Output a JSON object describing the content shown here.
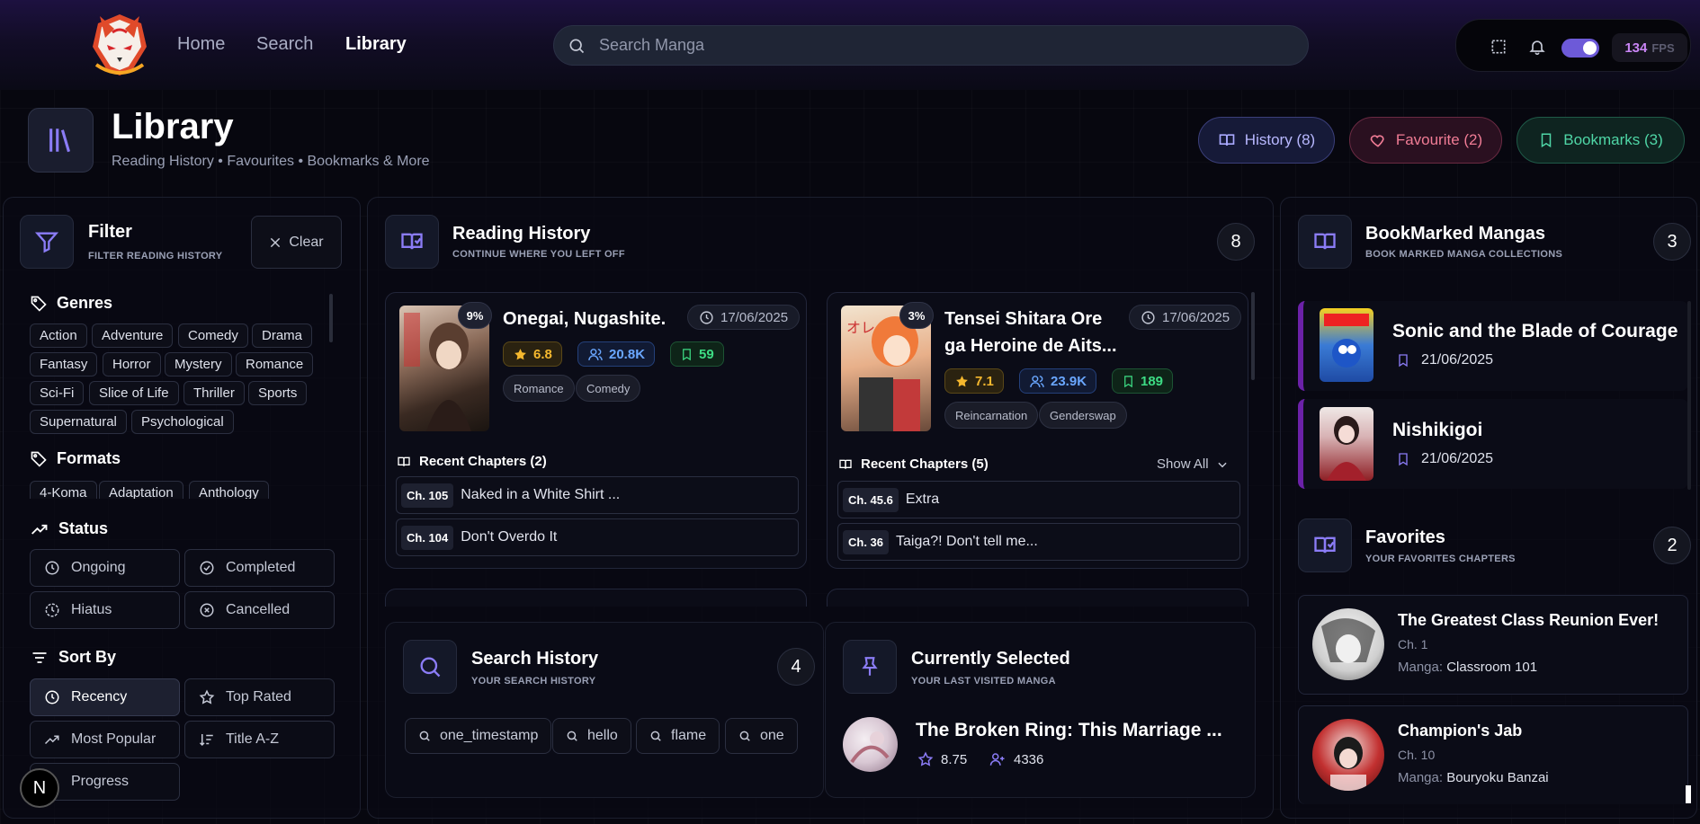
{
  "nav": {
    "home": "Home",
    "search": "Search",
    "library": "Library"
  },
  "search": {
    "placeholder": "Search Manga"
  },
  "fps": {
    "value": "134",
    "unit": "FPS"
  },
  "header": {
    "title": "Library",
    "subtitle": "Reading History • Favourites • Bookmarks & More"
  },
  "pills": {
    "history": "History (8)",
    "favourite": "Favourite (2)",
    "bookmarks": "Bookmarks (3)"
  },
  "filter": {
    "title": "Filter",
    "subtitle": "Filter reading history",
    "clear": "Clear",
    "genres_label": "Genres",
    "genres": [
      "Action",
      "Adventure",
      "Comedy",
      "Drama",
      "Fantasy",
      "Horror",
      "Mystery",
      "Romance",
      "Sci-Fi",
      "Slice of Life",
      "Thriller",
      "Sports",
      "Supernatural",
      "Psychological"
    ],
    "formats_label": "Formats",
    "formats": [
      "4-Koma",
      "Adaptation",
      "Anthology"
    ],
    "status_label": "Status",
    "status": [
      "Ongoing",
      "Completed",
      "Hiatus",
      "Cancelled"
    ],
    "sort_label": "Sort By",
    "sort": [
      "Recency",
      "Top Rated",
      "Most Popular",
      "Title A-Z",
      "Progress"
    ]
  },
  "reading": {
    "title": "Reading History",
    "subtitle": "Continue where you left off",
    "count": "8",
    "items": [
      {
        "progress": "9%",
        "title": "Onegai, Nugashite.",
        "date": "17/06/2025",
        "rating": "6.8",
        "views": "20.8K",
        "bookmarks": "59",
        "tags": [
          "Romance",
          "Comedy"
        ],
        "recent": "Recent Chapters (2)",
        "chapters": [
          {
            "num": "Ch. 105",
            "name": "Naked in a White Shirt ..."
          },
          {
            "num": "Ch. 104",
            "name": "Don't Overdo It"
          }
        ]
      },
      {
        "progress": "3%",
        "title_line1": "Tensei Shitara Ore",
        "title_line2": "ga Heroine de Aits...",
        "date": "17/06/2025",
        "rating": "7.1",
        "views": "23.9K",
        "bookmarks": "189",
        "tags": [
          "Reincarnation",
          "Genderswap"
        ],
        "recent": "Recent Chapters (5)",
        "show_all": "Show All",
        "chapters": [
          {
            "num": "Ch. 45.6",
            "name": "Extra"
          },
          {
            "num": "Ch. 36",
            "name": "Taiga?! Don't tell me..."
          }
        ]
      }
    ]
  },
  "search_history": {
    "title": "Search History",
    "subtitle": "Your search history",
    "count": "4",
    "terms": [
      "one_timestamp",
      "hello",
      "flame",
      "one"
    ]
  },
  "current": {
    "title": "Currently Selected",
    "subtitle": "Your last visited manga",
    "manga": "The Broken Ring: This Marriage ...",
    "rating": "8.75",
    "follows": "4336"
  },
  "bookmarked": {
    "title": "BookMarked Mangas",
    "subtitle": "Book marked manga collections",
    "count": "3",
    "items": [
      {
        "title": "Sonic and the Blade of Courage",
        "date": "21/06/2025"
      },
      {
        "title": "Nishikigoi",
        "date": "21/06/2025"
      }
    ]
  },
  "favorites": {
    "title": "Favorites",
    "subtitle": "Your favorites chapters",
    "count": "2",
    "manga_prefix": "Manga:",
    "items": [
      {
        "title": "The Greatest Class Reunion Ever!",
        "chapter": "Ch. 1",
        "manga": "Classroom 101"
      },
      {
        "title": "Champion's Jab",
        "chapter": "Ch. 10",
        "manga": "Bouryoku Banzai"
      }
    ]
  },
  "devtools": {
    "label": "N"
  },
  "colors": {
    "accent": "#8b7cf6",
    "rating": "#f5b82e",
    "views": "#6aa7ff",
    "bookmark": "#3ddc84",
    "favourite": "#f07c95",
    "bookmarks_pill": "#4fd6a6"
  }
}
